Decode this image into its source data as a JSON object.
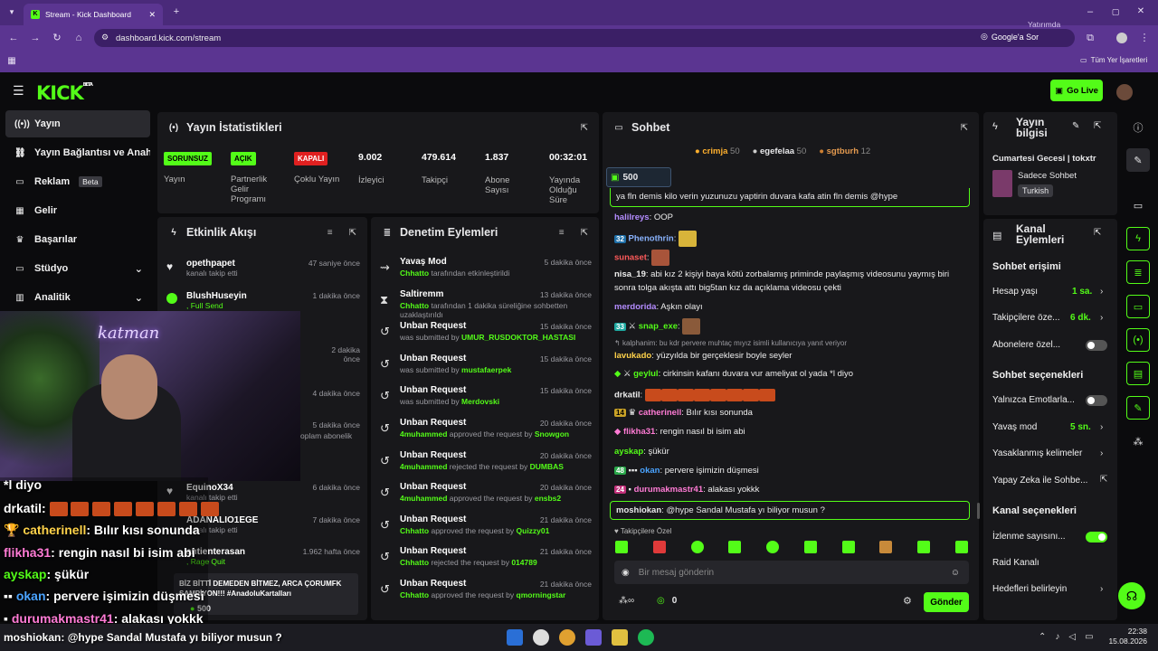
{
  "browser": {
    "tab_title": "Stream - Kick Dashboard",
    "url": "dashboard.kick.com/stream",
    "profile_label": "Yatırımda",
    "google_ask": "Google'a Sor",
    "bookmarks_label": "Tüm Yer İşaretleri"
  },
  "app": {
    "logo": "KICK",
    "logo_badge": "BETA",
    "go_live": "Go Live"
  },
  "sidebar": {
    "items": [
      {
        "label": "Yayın",
        "icon": "broadcast-icon"
      },
      {
        "label": "Yayın Bağlantısı ve Anahtar",
        "icon": "link-icon"
      },
      {
        "label": "Reklam",
        "badge": "Beta",
        "icon": "ad-icon"
      },
      {
        "label": "Gelir",
        "icon": "revenue-icon"
      },
      {
        "label": "Başarılar",
        "icon": "trophy-icon"
      },
      {
        "label": "Stüdyo",
        "icon": "studio-icon"
      },
      {
        "label": "Analitik",
        "icon": "analytics-icon"
      }
    ]
  },
  "stats": {
    "title": "Yayın İstatistikleri",
    "items": [
      {
        "badge": "SORUNSUZ",
        "label": "Yayın"
      },
      {
        "badge": "AÇIK",
        "label": "Partnerlik Gelir Programı"
      },
      {
        "badge": "KAPALI",
        "label": "Çoklu Yayın"
      },
      {
        "value": "9.002",
        "label": "İzleyici"
      },
      {
        "value": "479.614",
        "label": "Takipçi"
      },
      {
        "value": "1.837",
        "label": "Abone Sayısı"
      },
      {
        "value": "00:32:01",
        "label": "Yayında Olduğu Süre"
      }
    ]
  },
  "activity": {
    "title": "Etkinlik Akışı",
    "items": [
      {
        "user": "opethpapet",
        "sub": "kanalı takip etti",
        "time": "47 saniye önce"
      },
      {
        "user": "BlushHuseyin",
        "sub": ", Full Send",
        "time": "1 dakika önce"
      },
      {
        "time": "2 dakika önce"
      },
      {
        "time": "4 dakika önce"
      },
      {
        "sub": "oplam abonelik",
        "time": "5 dakika önce"
      },
      {
        "user": "EquinoX34",
        "sub": "kanalı takip etti",
        "time": "6 dakika önce"
      },
      {
        "user": "ADANALIO1EGE",
        "sub": "kanalı takip etti",
        "time": "7 dakika önce"
      },
      {
        "user": "antienterasan",
        "sub": ", Rage Quit",
        "time": "1.962 hafta önce"
      }
    ],
    "message": "BİZ BİTTİ DEMEDEN BİTMEZ, ARCA ÇORUMFK ŞAMPİYON!!! #AnadoluKartalları",
    "message_amount": "500"
  },
  "moderation": {
    "title": "Denetim Eylemleri",
    "items": [
      {
        "title": "Yavaş Mod",
        "actor": "Chhatto",
        "rest": "tarafından etkinleştirildi",
        "target": "",
        "time": "5 dakika önce",
        "icon": "slow-mode-icon"
      },
      {
        "title": "Saltiremm",
        "actor": "Chhatto",
        "rest": "tarafından 1 dakika süreliğine sohbetten uzaklaştırıldı",
        "target": "",
        "time": "13 dakika önce",
        "icon": "hourglass-icon"
      },
      {
        "title": "Unban Request",
        "actor": "",
        "rest": "was submitted by",
        "target": "UMUR_RUSDOKTOR_HASTASI",
        "time": "15 dakika önce",
        "icon": "unban-icon"
      },
      {
        "title": "Unban Request",
        "actor": "",
        "rest": "was submitted by",
        "target": "mustafaerpek",
        "time": "15 dakika önce",
        "icon": "unban-icon"
      },
      {
        "title": "Unban Request",
        "actor": "",
        "rest": "was submitted by",
        "target": "Merdovski",
        "time": "15 dakika önce",
        "icon": "unban-icon"
      },
      {
        "title": "Unban Request",
        "actor": "4muhammed",
        "rest": "approved the request by",
        "target": "Snowgon",
        "time": "20 dakika önce",
        "icon": "unban-icon"
      },
      {
        "title": "Unban Request",
        "actor": "4muhammed",
        "rest": "rejected the request by",
        "target": "DUMBAS",
        "time": "20 dakika önce",
        "icon": "unban-icon"
      },
      {
        "title": "Unban Request",
        "actor": "4muhammed",
        "rest": "approved the request by",
        "target": "ensbs2",
        "time": "20 dakika önce",
        "icon": "unban-icon"
      },
      {
        "title": "Unban Request",
        "actor": "Chhatto",
        "rest": "approved the request by",
        "target": "Quizzy01",
        "time": "21 dakika önce",
        "icon": "unban-icon"
      },
      {
        "title": "Unban Request",
        "actor": "Chhatto",
        "rest": "rejected the request by",
        "target": "014789",
        "time": "21 dakika önce",
        "icon": "unban-icon"
      },
      {
        "title": "Unban Request",
        "actor": "Chhatto",
        "rest": "approved the request by",
        "target": "qmorningstar",
        "time": "21 dakika önce",
        "icon": "unban-icon"
      }
    ]
  },
  "chat": {
    "title": "Sohbet",
    "top_gifters": [
      {
        "name": "crimja",
        "amount": "50"
      },
      {
        "name": "egefelaa",
        "amount": "50"
      },
      {
        "name": "sgtburh",
        "amount": "12"
      }
    ],
    "pinned_amount": "500",
    "pinned_text": "ya fln demis kilo verin yuzunuzu yaptirin duvara kafa atin fln demis @hype",
    "messages": [
      {
        "user": "halilreys",
        "color": "#b48cff",
        "text": "OOP"
      },
      {
        "user": "Phenothrin",
        "color": "#8ab4ff",
        "text": ""
      },
      {
        "user": "sunaset",
        "color": "#ff5a5a",
        "text": ""
      },
      {
        "user": "nisa_19",
        "color": "#ffffff",
        "text": "abi kız 2 kişiyi baya kötü zorbalamış priminde paylaşmış videosunu yaymış biri"
      },
      {
        "user": "",
        "color": "#ffffff",
        "text": "sonra tolga akışta attı big5tan kız da açıklama videosu çekti"
      },
      {
        "user": "merdorida",
        "color": "#b48cff",
        "text": "Aşkın olayı"
      },
      {
        "user": "snap_exe",
        "color": "#53fc18",
        "text": ""
      },
      {
        "user": "",
        "color": "#9a9aa0",
        "text": "kalphanim: bu kdr pervere muhtaç mıyız isimli kullanıcıya yanıt veriyor"
      },
      {
        "user": "lavukado",
        "color": "#ffd24a",
        "text": "yüzyılda bir gerçeklesir boyle seyler"
      },
      {
        "user": "geylul",
        "color": "#53fc18",
        "text": "cirkinsin kafanı duvara vur ameliyat ol yada *l diyo"
      },
      {
        "user": "drkatil",
        "color": "#ffffff",
        "text": ""
      },
      {
        "user": "catherinell",
        "color": "#ffd24a",
        "text": "Bılır kısı sonunda"
      },
      {
        "user": "flikha31",
        "color": "#ff7bd5",
        "text": "rengin nasıl bi isim abi"
      },
      {
        "user": "ayskap",
        "color": "#53fc18",
        "text": "şükür"
      },
      {
        "user": "okan",
        "color": "#4aa3ff",
        "text": "pervere işimizin düşmesi"
      },
      {
        "user": "durumakmastr41",
        "color": "#ff7bd5",
        "text": "alakası yokkk"
      },
      {
        "user": "moshiokan",
        "color": "#ffffff",
        "text": "@hype Sandal Mustafa yı biliyor musun ?"
      }
    ],
    "followers_only": "Takipçilere Özel",
    "input_placeholder": "Bir mesaj gönderin",
    "points": "0",
    "send_label": "Gönder"
  },
  "stream_info": {
    "title": "Yayın bilgisi",
    "stream_title": "Cumartesi Gecesi | tokxtr",
    "category": "Sadece Sohbet",
    "language": "Turkish"
  },
  "channel_actions": {
    "title": "Kanal Eylemleri",
    "chat_access": "Sohbet erişimi",
    "account_age_label": "Hesap yaşı",
    "account_age_value": "1 sa.",
    "followers_label": "Takipçilere öze...",
    "followers_value": "6 dk.",
    "subscribers_label": "Abonelere özel...",
    "chat_options": "Sohbet seçenekleri",
    "emotes_label": "Yalnızca Emotlarla...",
    "slow_label": "Yavaş mod",
    "slow_value": "5 sn.",
    "banned_words": "Yasaklanmış kelimeler",
    "ai_label": "Yapay Zeka ile Sohbe...",
    "channel_options": "Kanal seçenekleri",
    "view_count": "İzlenme sayısını...",
    "raid": "Raid Kanalı",
    "goals": "Hedefleri belirleyin"
  },
  "overlay": {
    "lines": [
      {
        "user": "",
        "text": "*l diyo"
      },
      {
        "user": "drkatil:",
        "text": ""
      },
      {
        "user": "catherinell",
        "text": ": Bılır kısı sonunda"
      },
      {
        "user": "flikha31",
        "text": ": rengin nasıl bi isim abi"
      },
      {
        "user": "ayskap",
        "text": ": şükür"
      },
      {
        "user": "okan",
        "text": ": pervere işimizin düşmesi"
      },
      {
        "user": "durumakmastr41",
        "text": ": alakası yokkk"
      },
      {
        "user": "moshiokan",
        "text": ": @hype Sandal Mustafa yı biliyor musun ?"
      }
    ]
  },
  "taskbar": {
    "time": "22:38",
    "date": "15.08.2026"
  },
  "colors": {
    "accent": "#53fc18",
    "panel": "#18181b",
    "browser": "#5b3591"
  }
}
